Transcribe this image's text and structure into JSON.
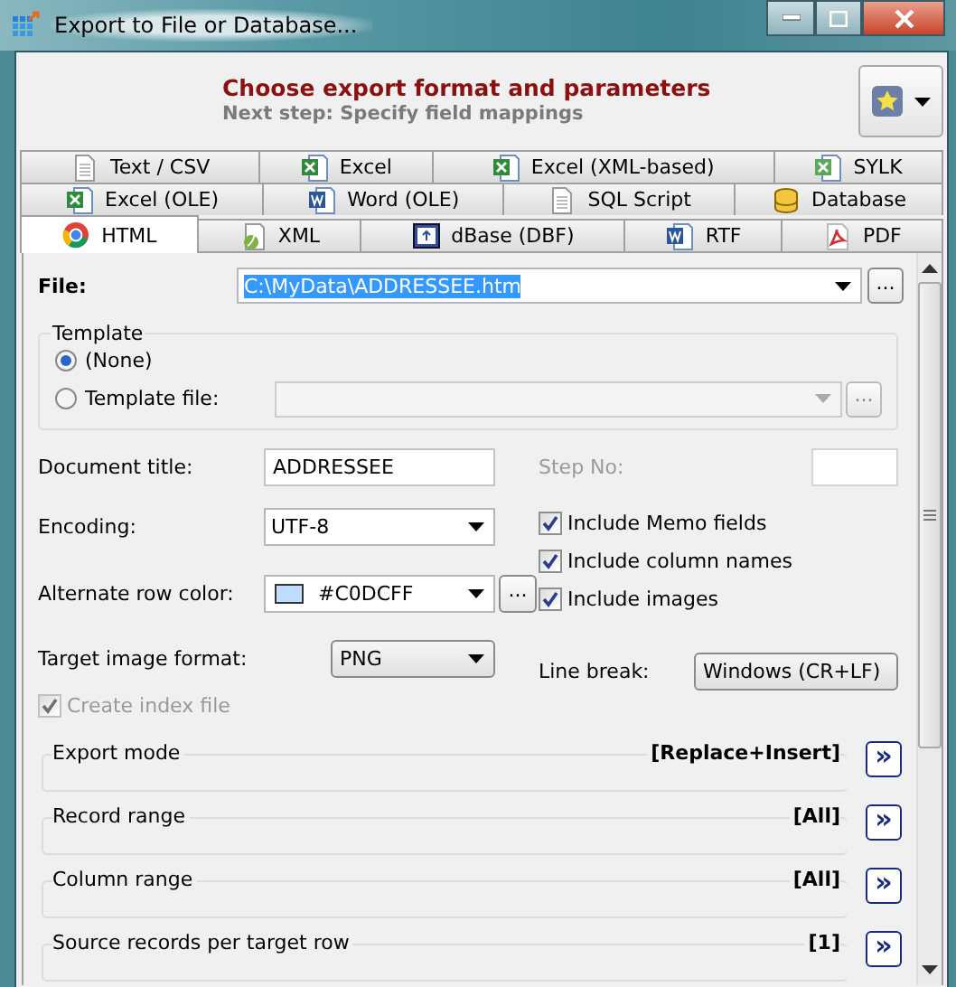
{
  "window": {
    "title": "Export to File or Database..."
  },
  "header": {
    "title": "Choose export format and parameters",
    "subtitle": "Next step: Specify field mappings"
  },
  "tab_rows": [
    [
      {
        "label": "Text / CSV",
        "kind": "text",
        "selected": false
      },
      {
        "label": "Excel",
        "kind": "excel",
        "selected": false
      },
      {
        "label": "Excel (XML-based)",
        "kind": "excel",
        "selected": false
      },
      {
        "label": "SYLK",
        "kind": "sylk",
        "selected": false
      }
    ],
    [
      {
        "label": "Excel (OLE)",
        "kind": "excel",
        "selected": false
      },
      {
        "label": "Word (OLE)",
        "kind": "word",
        "selected": false
      },
      {
        "label": "SQL Script",
        "kind": "text",
        "selected": false
      },
      {
        "label": "Database",
        "kind": "database",
        "selected": false
      }
    ],
    [
      {
        "label": "HTML",
        "kind": "html",
        "selected": true
      },
      {
        "label": "XML",
        "kind": "xml",
        "selected": false
      },
      {
        "label": "dBase (DBF)",
        "kind": "dbase",
        "selected": false
      },
      {
        "label": "RTF",
        "kind": "word",
        "selected": false
      },
      {
        "label": "PDF",
        "kind": "pdf",
        "selected": false
      }
    ]
  ],
  "file": {
    "label": "File:",
    "value": "C:\\MyData\\ADDRESSEE.htm",
    "selected": true,
    "button": "..."
  },
  "template": {
    "title": "Template",
    "options": [
      {
        "label": "(None)",
        "selected": true
      },
      {
        "label": "Template file:",
        "selected": false
      }
    ],
    "button": "..."
  },
  "document_title": {
    "label": "Document title:",
    "value": "ADDRESSEE"
  },
  "step_no": {
    "label": "Step No:",
    "disabled": true
  },
  "encoding": {
    "label": "Encoding:",
    "value": "UTF-8"
  },
  "alternate_row_color": {
    "label": "Alternate row color:",
    "value": "#C0DCFF",
    "color": "#c0dcff",
    "button": "..."
  },
  "target_image_format": {
    "label": "Target image format:",
    "value": "PNG"
  },
  "checkboxes": [
    {
      "label": "Include Memo fields",
      "checked": true,
      "disabled": false
    },
    {
      "label": "Include column names",
      "checked": true,
      "disabled": false
    },
    {
      "label": "Include images",
      "checked": true,
      "disabled": false
    }
  ],
  "line_break": {
    "label": "Line break:",
    "value": "Windows (CR+LF)"
  },
  "create_index_file": {
    "label": "Create index file",
    "checked": true,
    "disabled": true
  },
  "sections": [
    {
      "label": "Export mode",
      "value": "[Replace+Insert]",
      "button": "»"
    },
    {
      "label": "Record range",
      "value": "[All]",
      "button": "»"
    },
    {
      "label": "Column range",
      "value": "[All]",
      "button": "»"
    },
    {
      "label": "Source records per target row",
      "value": "[1]",
      "button": "»"
    }
  ]
}
